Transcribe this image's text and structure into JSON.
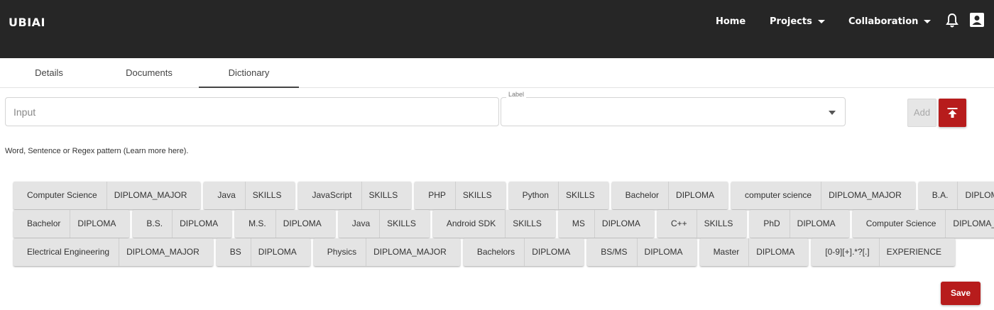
{
  "header": {
    "brand": "UBIAI",
    "nav": [
      {
        "label": "Home"
      },
      {
        "label": "Projects"
      },
      {
        "label": "Collaboration"
      }
    ],
    "icons": [
      "bell-icon",
      "user-icon"
    ]
  },
  "tabs": [
    {
      "label": "Details"
    },
    {
      "label": "Documents"
    },
    {
      "label": "Dictionary",
      "active": true
    }
  ],
  "form": {
    "input_placeholder": "Input",
    "input_value": "",
    "label_caption": "Label",
    "label_value": "",
    "add_label": "Add",
    "help_text": "Word, Sentence or Regex pattern (Learn more here)."
  },
  "chips": [
    [
      {
        "text": "Computer Science",
        "label": "DIPLOMA_MAJOR"
      },
      {
        "text": "Java",
        "label": "SKILLS"
      },
      {
        "text": "JavaScript",
        "label": "SKILLS"
      },
      {
        "text": "PHP",
        "label": "SKILLS"
      },
      {
        "text": "Python",
        "label": "SKILLS"
      },
      {
        "text": "Bachelor",
        "label": "DIPLOMA"
      },
      {
        "text": "computer science",
        "label": "DIPLOMA_MAJOR"
      },
      {
        "text": "B.A.",
        "label": "DIPLOMA"
      }
    ],
    [
      {
        "text": "Bachelor",
        "label": "DIPLOMA"
      },
      {
        "text": "B.S.",
        "label": "DIPLOMA"
      },
      {
        "text": "M.S.",
        "label": "DIPLOMA"
      },
      {
        "text": "Java",
        "label": "SKILLS"
      },
      {
        "text": "Android SDK",
        "label": "SKILLS"
      },
      {
        "text": "MS",
        "label": "DIPLOMA"
      },
      {
        "text": "C++",
        "label": "SKILLS"
      },
      {
        "text": "PhD",
        "label": "DIPLOMA"
      },
      {
        "text": "Computer Science",
        "label": "DIPLOMA_MAJOR"
      }
    ],
    [
      {
        "text": "Electrical Engineering",
        "label": "DIPLOMA_MAJOR"
      },
      {
        "text": "BS",
        "label": "DIPLOMA"
      },
      {
        "text": "Physics",
        "label": "DIPLOMA_MAJOR"
      },
      {
        "text": "Bachelors",
        "label": "DIPLOMA"
      },
      {
        "text": "BS/MS",
        "label": "DIPLOMA"
      },
      {
        "text": "Master",
        "label": "DIPLOMA"
      },
      {
        "text": "[0-9][+].*?[.]",
        "label": "EXPERIENCE"
      }
    ]
  ],
  "save_label": "Save",
  "colors": {
    "header_bg": "#262626",
    "accent": "#b71c1c",
    "chip_bg": "#e4e4e4"
  }
}
